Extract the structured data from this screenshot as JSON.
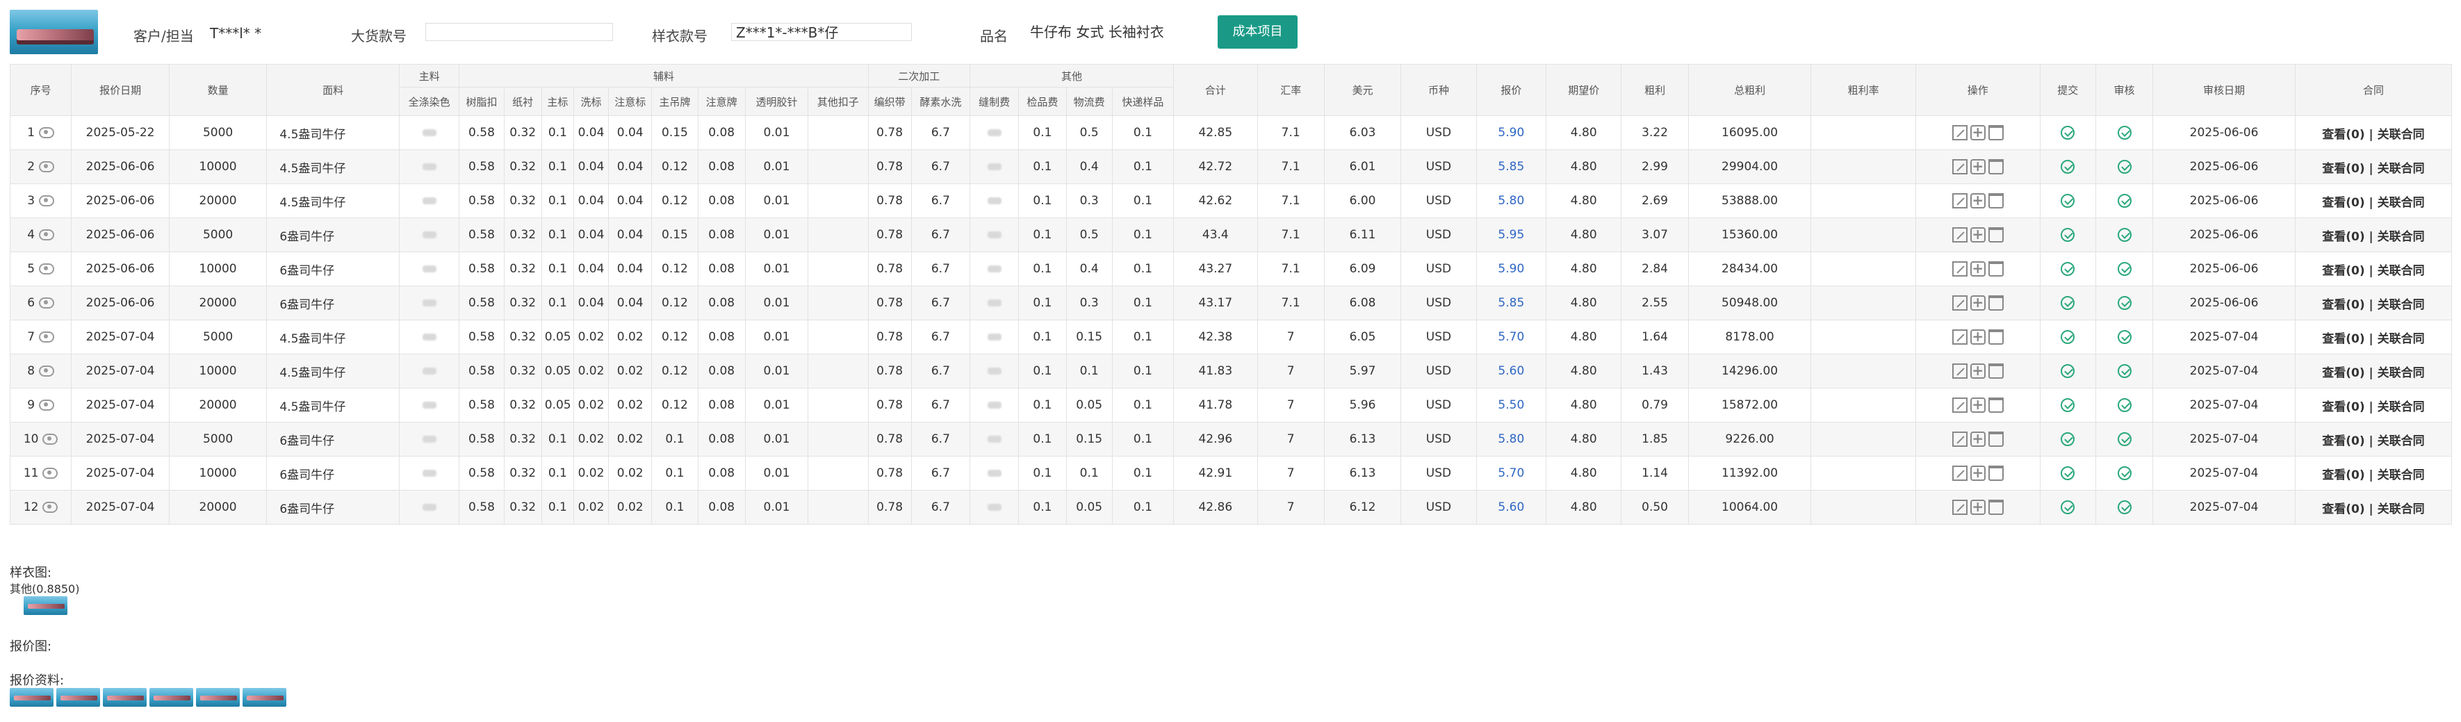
{
  "header": {
    "customer_label": "客户/担当",
    "customer_value": "T***l* *",
    "bulk_style_label": "大货款号",
    "bulk_style_value": "",
    "sample_style_label": "样衣款号",
    "sample_style_value": "Z***1*-***B*仔",
    "product_label": "品名",
    "product_value": "牛仔布 女式 长袖衬衣",
    "cost_button": "成本项目"
  },
  "table": {
    "group_headers": {
      "main": "主料",
      "aux": "辅料",
      "secondary": "二次加工",
      "other": "其他"
    },
    "columns": {
      "seq": "序号",
      "date": "报价日期",
      "qty": "数量",
      "fabric": "面料",
      "dye": "全涤染色",
      "resin_btn": "树脂扣",
      "lining": "纸衬",
      "main_label": "主标",
      "wash_label": "洗标",
      "note_label": "注意标",
      "hangtag": "主吊牌",
      "note_tag": "注意牌",
      "clear_tape": "透明胶针",
      "other_btn": "其他扣子",
      "woven_tape": "编织带",
      "enzyme_wash": "酵素水洗",
      "sewing": "缝制费",
      "inspection": "检品费",
      "logistics": "物流费",
      "express": "快递样品",
      "total": "合计",
      "rate": "汇率",
      "usd": "美元",
      "currency": "币种",
      "quote": "报价",
      "expected": "期望价",
      "profit": "粗利",
      "total_profit": "总粗利",
      "profit_rate": "粗利率",
      "ops": "操作",
      "submit": "提交",
      "review": "审核",
      "review_date": "审核日期",
      "contract": "合同"
    },
    "rows": [
      {
        "seq": "1",
        "date": "2025-05-22",
        "qty": "5000",
        "fabric": "4.5盎司牛仔",
        "resin_btn": "0.58",
        "lining": "0.32",
        "main_label": "0.1",
        "wash_label": "0.04",
        "note_label": "0.04",
        "hangtag": "0.15",
        "note_tag": "0.08",
        "clear_tape": "0.01",
        "woven_tape": "0.78",
        "enzyme_wash": "6.7",
        "inspection": "0.1",
        "logistics": "0.5",
        "express": "0.1",
        "total": "42.85",
        "rate": "7.1",
        "usd": "6.03",
        "currency": "USD",
        "quote": "5.90",
        "expected": "4.80",
        "profit": "3.22",
        "total_profit": "16095.00",
        "review_date": "2025-06-06",
        "contract": "查看(0) | 关联合同"
      },
      {
        "seq": "2",
        "date": "2025-06-06",
        "qty": "10000",
        "fabric": "4.5盎司牛仔",
        "resin_btn": "0.58",
        "lining": "0.32",
        "main_label": "0.1",
        "wash_label": "0.04",
        "note_label": "0.04",
        "hangtag": "0.12",
        "note_tag": "0.08",
        "clear_tape": "0.01",
        "woven_tape": "0.78",
        "enzyme_wash": "6.7",
        "inspection": "0.1",
        "logistics": "0.4",
        "express": "0.1",
        "total": "42.72",
        "rate": "7.1",
        "usd": "6.01",
        "currency": "USD",
        "quote": "5.85",
        "expected": "4.80",
        "profit": "2.99",
        "total_profit": "29904.00",
        "review_date": "2025-06-06",
        "contract": "查看(0) | 关联合同"
      },
      {
        "seq": "3",
        "date": "2025-06-06",
        "qty": "20000",
        "fabric": "4.5盎司牛仔",
        "resin_btn": "0.58",
        "lining": "0.32",
        "main_label": "0.1",
        "wash_label": "0.04",
        "note_label": "0.04",
        "hangtag": "0.12",
        "note_tag": "0.08",
        "clear_tape": "0.01",
        "woven_tape": "0.78",
        "enzyme_wash": "6.7",
        "inspection": "0.1",
        "logistics": "0.3",
        "express": "0.1",
        "total": "42.62",
        "rate": "7.1",
        "usd": "6.00",
        "currency": "USD",
        "quote": "5.80",
        "expected": "4.80",
        "profit": "2.69",
        "total_profit": "53888.00",
        "review_date": "2025-06-06",
        "contract": "查看(0) | 关联合同"
      },
      {
        "seq": "4",
        "date": "2025-06-06",
        "qty": "5000",
        "fabric": "6盎司牛仔",
        "resin_btn": "0.58",
        "lining": "0.32",
        "main_label": "0.1",
        "wash_label": "0.04",
        "note_label": "0.04",
        "hangtag": "0.15",
        "note_tag": "0.08",
        "clear_tape": "0.01",
        "woven_tape": "0.78",
        "enzyme_wash": "6.7",
        "inspection": "0.1",
        "logistics": "0.5",
        "express": "0.1",
        "total": "43.4",
        "rate": "7.1",
        "usd": "6.11",
        "currency": "USD",
        "quote": "5.95",
        "expected": "4.80",
        "profit": "3.07",
        "total_profit": "15360.00",
        "review_date": "2025-06-06",
        "contract": "查看(0) | 关联合同"
      },
      {
        "seq": "5",
        "date": "2025-06-06",
        "qty": "10000",
        "fabric": "6盎司牛仔",
        "resin_btn": "0.58",
        "lining": "0.32",
        "main_label": "0.1",
        "wash_label": "0.04",
        "note_label": "0.04",
        "hangtag": "0.12",
        "note_tag": "0.08",
        "clear_tape": "0.01",
        "woven_tape": "0.78",
        "enzyme_wash": "6.7",
        "inspection": "0.1",
        "logistics": "0.4",
        "express": "0.1",
        "total": "43.27",
        "rate": "7.1",
        "usd": "6.09",
        "currency": "USD",
        "quote": "5.90",
        "expected": "4.80",
        "profit": "2.84",
        "total_profit": "28434.00",
        "review_date": "2025-06-06",
        "contract": "查看(0) | 关联合同"
      },
      {
        "seq": "6",
        "date": "2025-06-06",
        "qty": "20000",
        "fabric": "6盎司牛仔",
        "resin_btn": "0.58",
        "lining": "0.32",
        "main_label": "0.1",
        "wash_label": "0.04",
        "note_label": "0.04",
        "hangtag": "0.12",
        "note_tag": "0.08",
        "clear_tape": "0.01",
        "woven_tape": "0.78",
        "enzyme_wash": "6.7",
        "inspection": "0.1",
        "logistics": "0.3",
        "express": "0.1",
        "total": "43.17",
        "rate": "7.1",
        "usd": "6.08",
        "currency": "USD",
        "quote": "5.85",
        "expected": "4.80",
        "profit": "2.55",
        "total_profit": "50948.00",
        "review_date": "2025-06-06",
        "contract": "查看(0) | 关联合同"
      },
      {
        "seq": "7",
        "date": "2025-07-04",
        "qty": "5000",
        "fabric": "4.5盎司牛仔",
        "resin_btn": "0.58",
        "lining": "0.32",
        "main_label": "0.05",
        "wash_label": "0.02",
        "note_label": "0.02",
        "hangtag": "0.12",
        "note_tag": "0.08",
        "clear_tape": "0.01",
        "woven_tape": "0.78",
        "enzyme_wash": "6.7",
        "inspection": "0.1",
        "logistics": "0.15",
        "express": "0.1",
        "total": "42.38",
        "rate": "7",
        "usd": "6.05",
        "currency": "USD",
        "quote": "5.70",
        "expected": "4.80",
        "profit": "1.64",
        "total_profit": "8178.00",
        "review_date": "2025-07-04",
        "contract": "查看(0) | 关联合同"
      },
      {
        "seq": "8",
        "date": "2025-07-04",
        "qty": "10000",
        "fabric": "4.5盎司牛仔",
        "resin_btn": "0.58",
        "lining": "0.32",
        "main_label": "0.05",
        "wash_label": "0.02",
        "note_label": "0.02",
        "hangtag": "0.12",
        "note_tag": "0.08",
        "clear_tape": "0.01",
        "woven_tape": "0.78",
        "enzyme_wash": "6.7",
        "inspection": "0.1",
        "logistics": "0.1",
        "express": "0.1",
        "total": "41.83",
        "rate": "7",
        "usd": "5.97",
        "currency": "USD",
        "quote": "5.60",
        "expected": "4.80",
        "profit": "1.43",
        "total_profit": "14296.00",
        "review_date": "2025-07-04",
        "contract": "查看(0) | 关联合同"
      },
      {
        "seq": "9",
        "date": "2025-07-04",
        "qty": "20000",
        "fabric": "4.5盎司牛仔",
        "resin_btn": "0.58",
        "lining": "0.32",
        "main_label": "0.05",
        "wash_label": "0.02",
        "note_label": "0.02",
        "hangtag": "0.12",
        "note_tag": "0.08",
        "clear_tape": "0.01",
        "woven_tape": "0.78",
        "enzyme_wash": "6.7",
        "inspection": "0.1",
        "logistics": "0.05",
        "express": "0.1",
        "total": "41.78",
        "rate": "7",
        "usd": "5.96",
        "currency": "USD",
        "quote": "5.50",
        "expected": "4.80",
        "profit": "0.79",
        "total_profit": "15872.00",
        "review_date": "2025-07-04",
        "contract": "查看(0) | 关联合同"
      },
      {
        "seq": "10",
        "date": "2025-07-04",
        "qty": "5000",
        "fabric": "6盎司牛仔",
        "resin_btn": "0.58",
        "lining": "0.32",
        "main_label": "0.1",
        "wash_label": "0.02",
        "note_label": "0.02",
        "hangtag": "0.1",
        "note_tag": "0.08",
        "clear_tape": "0.01",
        "woven_tape": "0.78",
        "enzyme_wash": "6.7",
        "inspection": "0.1",
        "logistics": "0.15",
        "express": "0.1",
        "total": "42.96",
        "rate": "7",
        "usd": "6.13",
        "currency": "USD",
        "quote": "5.80",
        "expected": "4.80",
        "profit": "1.85",
        "total_profit": "9226.00",
        "review_date": "2025-07-04",
        "contract": "查看(0) | 关联合同"
      },
      {
        "seq": "11",
        "date": "2025-07-04",
        "qty": "10000",
        "fabric": "6盎司牛仔",
        "resin_btn": "0.58",
        "lining": "0.32",
        "main_label": "0.1",
        "wash_label": "0.02",
        "note_label": "0.02",
        "hangtag": "0.1",
        "note_tag": "0.08",
        "clear_tape": "0.01",
        "woven_tape": "0.78",
        "enzyme_wash": "6.7",
        "inspection": "0.1",
        "logistics": "0.1",
        "express": "0.1",
        "total": "42.91",
        "rate": "7",
        "usd": "6.13",
        "currency": "USD",
        "quote": "5.70",
        "expected": "4.80",
        "profit": "1.14",
        "total_profit": "11392.00",
        "review_date": "2025-07-04",
        "contract": "查看(0) | 关联合同"
      },
      {
        "seq": "12",
        "date": "2025-07-04",
        "qty": "20000",
        "fabric": "6盎司牛仔",
        "resin_btn": "0.58",
        "lining": "0.32",
        "main_label": "0.1",
        "wash_label": "0.02",
        "note_label": "0.02",
        "hangtag": "0.1",
        "note_tag": "0.08",
        "clear_tape": "0.01",
        "woven_tape": "0.78",
        "enzyme_wash": "6.7",
        "inspection": "0.1",
        "logistics": "0.05",
        "express": "0.1",
        "total": "42.86",
        "rate": "7",
        "usd": "6.12",
        "currency": "USD",
        "quote": "5.60",
        "expected": "4.80",
        "profit": "0.50",
        "total_profit": "10064.00",
        "review_date": "2025-07-04",
        "contract": "查看(0) | 关联合同"
      }
    ]
  },
  "sections": {
    "sample_image_label": "样衣图:",
    "sample_image_caption": "其他(0.8850)",
    "quote_image_label": "报价图:",
    "quote_docs_label": "报价资料:"
  },
  "colors": {
    "accent": "#1a9a86",
    "link_blue": "#2f66c4",
    "check_green": "#2aa87a"
  }
}
